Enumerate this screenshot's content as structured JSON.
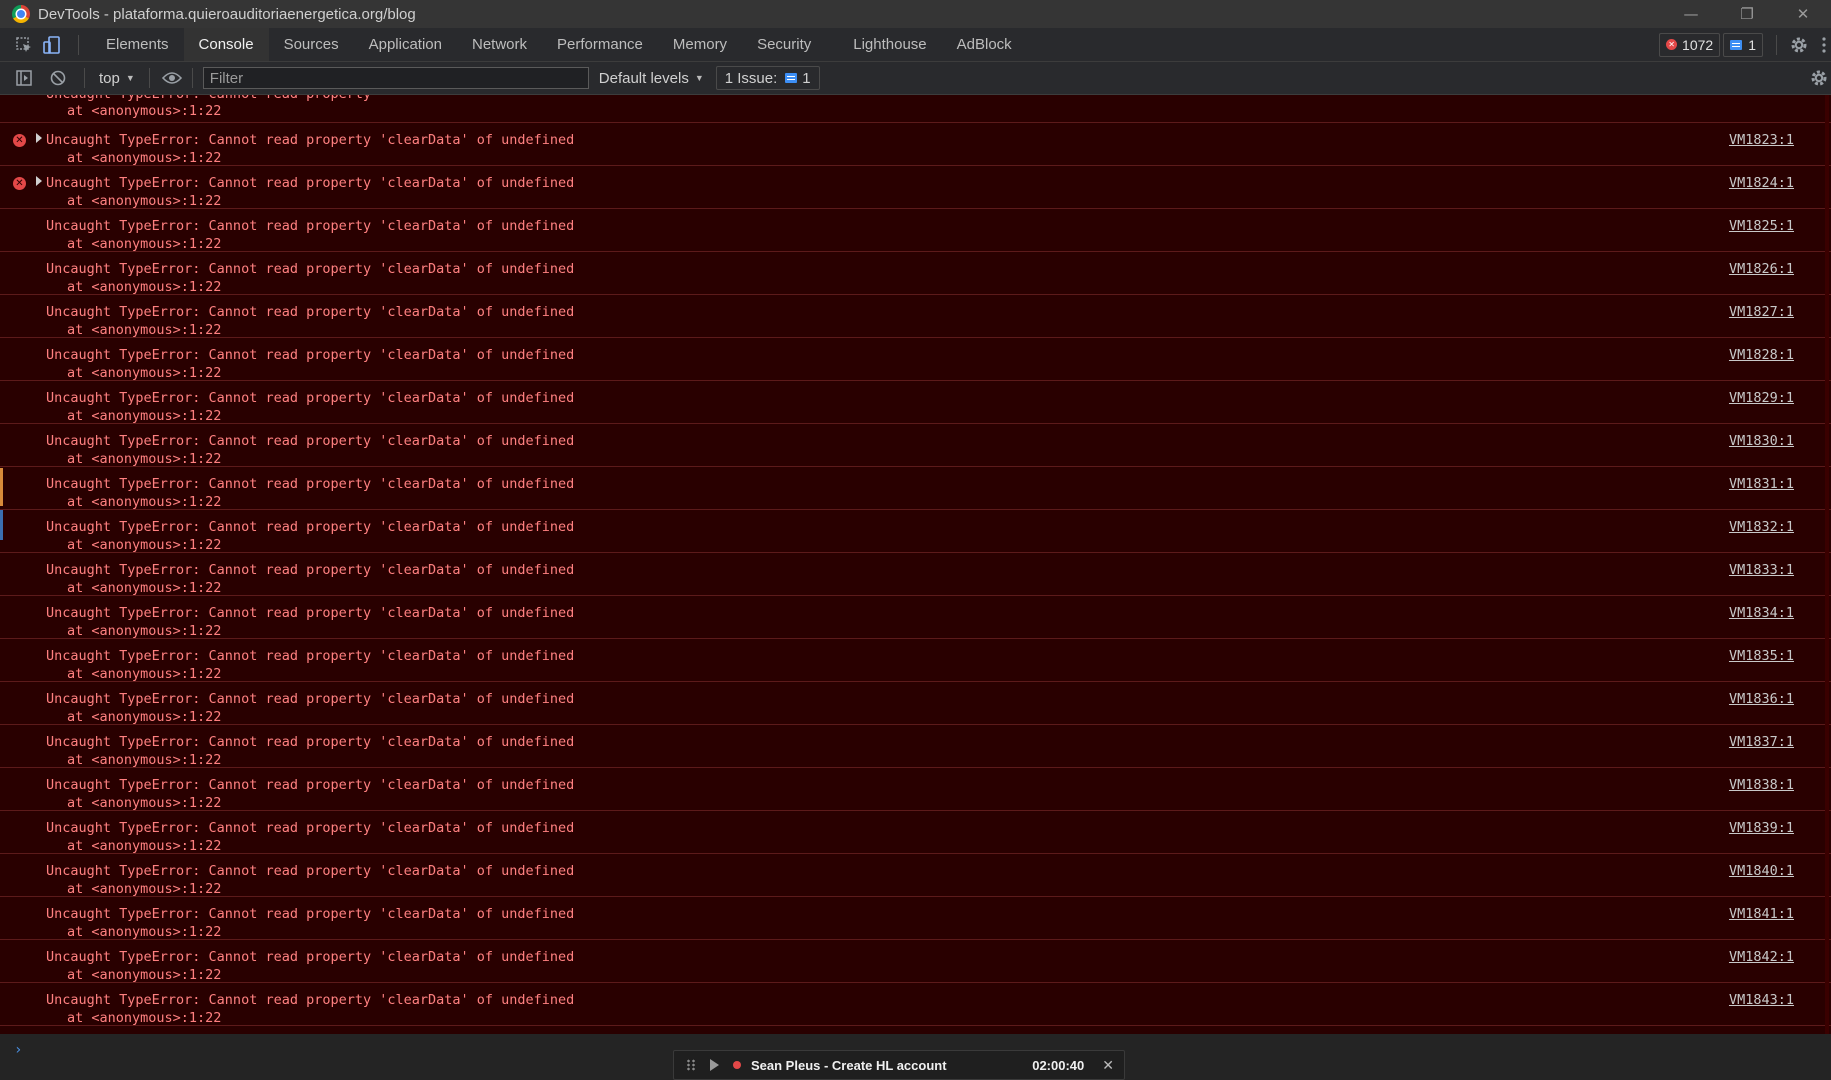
{
  "window": {
    "title": "DevTools - plataforma.quieroauditoriaenergetica.org/blog",
    "minimize_glyph": "—",
    "restore_glyph": "❐",
    "close_glyph": "✕"
  },
  "tabs": [
    {
      "label": "Elements"
    },
    {
      "label": "Console"
    },
    {
      "label": "Sources"
    },
    {
      "label": "Application"
    },
    {
      "label": "Network"
    },
    {
      "label": "Performance"
    },
    {
      "label": "Memory"
    },
    {
      "label": "Security"
    },
    {
      "label": "Lighthouse"
    },
    {
      "label": "AdBlock"
    }
  ],
  "active_tab": "Console",
  "counters": {
    "errors": "1072",
    "messages": "1"
  },
  "console_toolbar": {
    "context": "top",
    "filter_placeholder": "Filter",
    "levels": "Default levels",
    "issues_label": "1 Issue:",
    "issues_count": "1"
  },
  "partial_message": {
    "line1": "Uncaught TypeError: Cannot read property",
    "line2": "at <anonymous>:1:22"
  },
  "messages": [
    {
      "text": "Uncaught TypeError: Cannot read property 'clearData' of undefined",
      "stack": "at <anonymous>:1:22",
      "source": "VM1823:1",
      "icon": true
    },
    {
      "text": "Uncaught TypeError: Cannot read property 'clearData' of undefined",
      "stack": "at <anonymous>:1:22",
      "source": "VM1824:1",
      "icon": true
    },
    {
      "text": "Uncaught TypeError: Cannot read property 'clearData' of undefined",
      "stack": "at <anonymous>:1:22",
      "source": "VM1825:1",
      "icon": false
    },
    {
      "text": "Uncaught TypeError: Cannot read property 'clearData' of undefined",
      "stack": "at <anonymous>:1:22",
      "source": "VM1826:1",
      "icon": false
    },
    {
      "text": "Uncaught TypeError: Cannot read property 'clearData' of undefined",
      "stack": "at <anonymous>:1:22",
      "source": "VM1827:1",
      "icon": false
    },
    {
      "text": "Uncaught TypeError: Cannot read property 'clearData' of undefined",
      "stack": "at <anonymous>:1:22",
      "source": "VM1828:1",
      "icon": false
    },
    {
      "text": "Uncaught TypeError: Cannot read property 'clearData' of undefined",
      "stack": "at <anonymous>:1:22",
      "source": "VM1829:1",
      "icon": false
    },
    {
      "text": "Uncaught TypeError: Cannot read property 'clearData' of undefined",
      "stack": "at <anonymous>:1:22",
      "source": "VM1830:1",
      "icon": false
    },
    {
      "text": "Uncaught TypeError: Cannot read property 'clearData' of undefined",
      "stack": "at <anonymous>:1:22",
      "source": "VM1831:1",
      "icon": false
    },
    {
      "text": "Uncaught TypeError: Cannot read property 'clearData' of undefined",
      "stack": "at <anonymous>:1:22",
      "source": "VM1832:1",
      "icon": false
    },
    {
      "text": "Uncaught TypeError: Cannot read property 'clearData' of undefined",
      "stack": "at <anonymous>:1:22",
      "source": "VM1833:1",
      "icon": false
    },
    {
      "text": "Uncaught TypeError: Cannot read property 'clearData' of undefined",
      "stack": "at <anonymous>:1:22",
      "source": "VM1834:1",
      "icon": false
    },
    {
      "text": "Uncaught TypeError: Cannot read property 'clearData' of undefined",
      "stack": "at <anonymous>:1:22",
      "source": "VM1835:1",
      "icon": false
    },
    {
      "text": "Uncaught TypeError: Cannot read property 'clearData' of undefined",
      "stack": "at <anonymous>:1:22",
      "source": "VM1836:1",
      "icon": false
    },
    {
      "text": "Uncaught TypeError: Cannot read property 'clearData' of undefined",
      "stack": "at <anonymous>:1:22",
      "source": "VM1837:1",
      "icon": false
    },
    {
      "text": "Uncaught TypeError: Cannot read property 'clearData' of undefined",
      "stack": "at <anonymous>:1:22",
      "source": "VM1838:1",
      "icon": false
    },
    {
      "text": "Uncaught TypeError: Cannot read property 'clearData' of undefined",
      "stack": "at <anonymous>:1:22",
      "source": "VM1839:1",
      "icon": false
    },
    {
      "text": "Uncaught TypeError: Cannot read property 'clearData' of undefined",
      "stack": "at <anonymous>:1:22",
      "source": "VM1840:1",
      "icon": false
    },
    {
      "text": "Uncaught TypeError: Cannot read property 'clearData' of undefined",
      "stack": "at <anonymous>:1:22",
      "source": "VM1841:1",
      "icon": false
    },
    {
      "text": "Uncaught TypeError: Cannot read property 'clearData' of undefined",
      "stack": "at <anonymous>:1:22",
      "source": "VM1842:1",
      "icon": false
    },
    {
      "text": "Uncaught TypeError: Cannot read property 'clearData' of undefined",
      "stack": "at <anonymous>:1:22",
      "source": "VM1843:1",
      "icon": false
    }
  ],
  "prompt_glyph": "›",
  "recorder": {
    "title": "Sean Pleus - Create HL account",
    "time": "02:00:40",
    "close_glyph": "✕"
  },
  "colors": {
    "error_text": "#ff8080",
    "error_background": "#290000",
    "error_icon": "#e34848",
    "accent_blue": "#3d8ff5"
  }
}
